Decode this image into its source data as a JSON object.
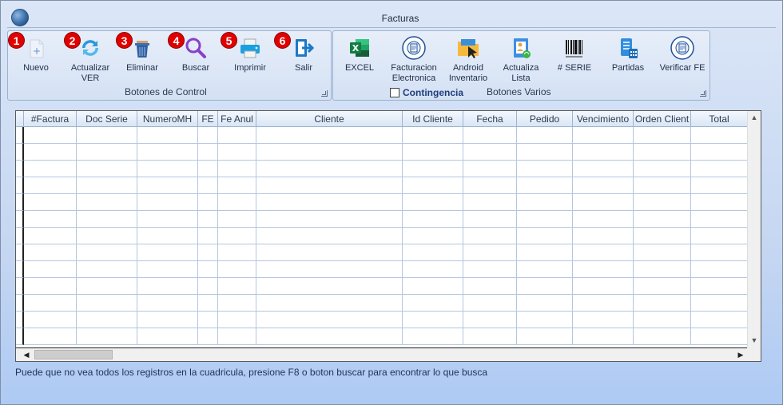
{
  "window": {
    "title": "Facturas"
  },
  "control_group": {
    "caption": "Botones de Control",
    "buttons": [
      {
        "badge": "1",
        "label": "Nuevo",
        "icon": "new-document-icon"
      },
      {
        "badge": "2",
        "label": "Actualizar VER",
        "icon": "refresh-icon"
      },
      {
        "badge": "3",
        "label": "Eliminar",
        "icon": "trash-icon"
      },
      {
        "badge": "4",
        "label": "Buscar",
        "icon": "search-icon"
      },
      {
        "badge": "5",
        "label": "Imprimir",
        "icon": "printer-icon"
      },
      {
        "badge": "6",
        "label": "Salir",
        "icon": "exit-icon"
      }
    ]
  },
  "varios_group": {
    "caption": "Botones Varios",
    "contingencia_label": "Contingencia",
    "contingencia_checked": false,
    "buttons": [
      {
        "label": "EXCEL",
        "icon": "excel-icon"
      },
      {
        "label": "Facturacion Electronica",
        "icon": "facturacion-seal-icon"
      },
      {
        "label": "Android Inventario",
        "icon": "folder-cursor-icon"
      },
      {
        "label": "Actualiza Lista",
        "icon": "update-list-icon"
      },
      {
        "label": "# SERIE",
        "icon": "barcode-icon"
      },
      {
        "label": "Partidas",
        "icon": "calculator-list-icon"
      },
      {
        "label": "Verificar FE",
        "icon": "verify-seal-icon"
      }
    ]
  },
  "grid": {
    "columns": [
      "#Factura",
      "Doc Serie",
      "NumeroMH",
      "FE",
      "Fe Anul",
      "Cliente",
      "Id Cliente",
      "Fecha",
      "Pedido",
      "Vencimiento",
      "Orden Client",
      "Total"
    ]
  },
  "status": {
    "text": "Puede que no vea todos los registros en la cuadricula, presione F8 o boton buscar para encontrar lo que busca"
  }
}
